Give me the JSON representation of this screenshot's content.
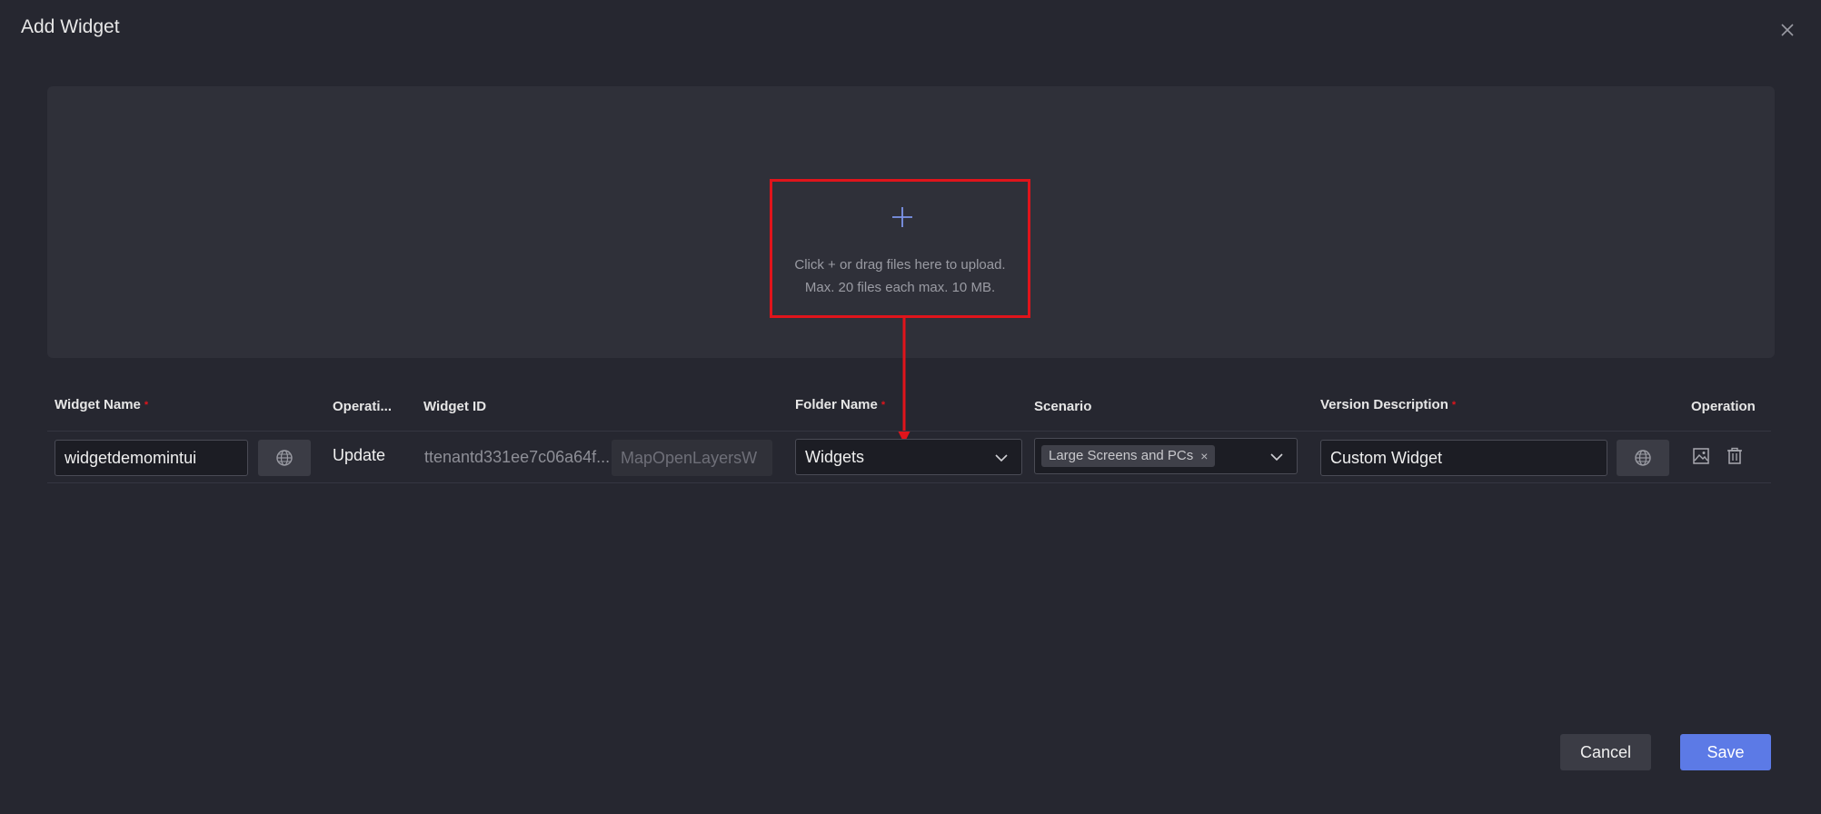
{
  "dialog": {
    "title": "Add Widget"
  },
  "upload": {
    "line1": "Click + or drag files here to upload.",
    "line2": "Max. 20 files each max. 10 MB."
  },
  "table": {
    "headers": {
      "widget_name": "Widget Name",
      "operation_type": "Operati...",
      "widget_id": "Widget ID",
      "folder_name": "Folder Name",
      "scenario": "Scenario",
      "version_description": "Version Description",
      "operation": "Operation"
    },
    "required_mark": "*",
    "row": {
      "widget_name": "widgetdemomintui",
      "operation_type": "Update",
      "widget_id_prefix": "ttenantd331ee7c06a64f...",
      "widget_id_suffix": "MapOpenLayersW",
      "folder_name": "Widgets",
      "scenario_tag": "Large Screens and PCs",
      "tag_close": "×",
      "version_description": "Custom Widget"
    }
  },
  "footer": {
    "cancel": "Cancel",
    "save": "Save"
  },
  "colors": {
    "background": "#262730",
    "accent": "#5c7ae6",
    "highlight": "#e0141b"
  },
  "icons": [
    "close-icon",
    "plus-icon",
    "globe-icon",
    "chevron-down-icon",
    "image-icon",
    "trash-icon"
  ]
}
